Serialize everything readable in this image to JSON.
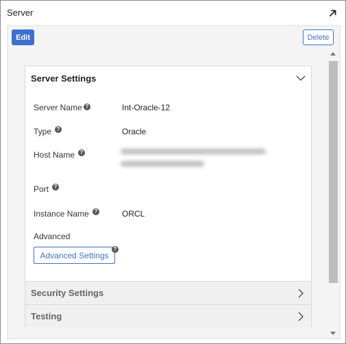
{
  "window": {
    "title": "Server"
  },
  "toolbar": {
    "edit_label": "Edit",
    "delete_label": "Delete"
  },
  "sections": {
    "server_settings": {
      "title": "Server Settings",
      "expanded": true,
      "fields": {
        "server_name": {
          "label": "Server Name",
          "value": "Int-Oracle-12"
        },
        "type": {
          "label": "Type",
          "value": "Oracle"
        },
        "host_name": {
          "label": "Host Name",
          "value": ""
        },
        "port": {
          "label": "Port",
          "value": ""
        },
        "instance_name": {
          "label": "Instance Name",
          "value": "ORCL"
        }
      },
      "advanced": {
        "label": "Advanced",
        "button_label": "Advanced Settings"
      }
    },
    "security_settings": {
      "title": "Security Settings",
      "expanded": false
    },
    "testing": {
      "title": "Testing",
      "expanded": false
    }
  },
  "icons": {
    "expand": "expand-arrow-icon",
    "help": "help-icon",
    "chevron_down": "chevron-down-icon",
    "chevron_right": "chevron-right-icon"
  },
  "colors": {
    "accent": "#3f6fcf",
    "panel_bg": "#f4f4f4",
    "collapsed_header_bg": "#f0f0f0",
    "help_icon": "#555555"
  }
}
